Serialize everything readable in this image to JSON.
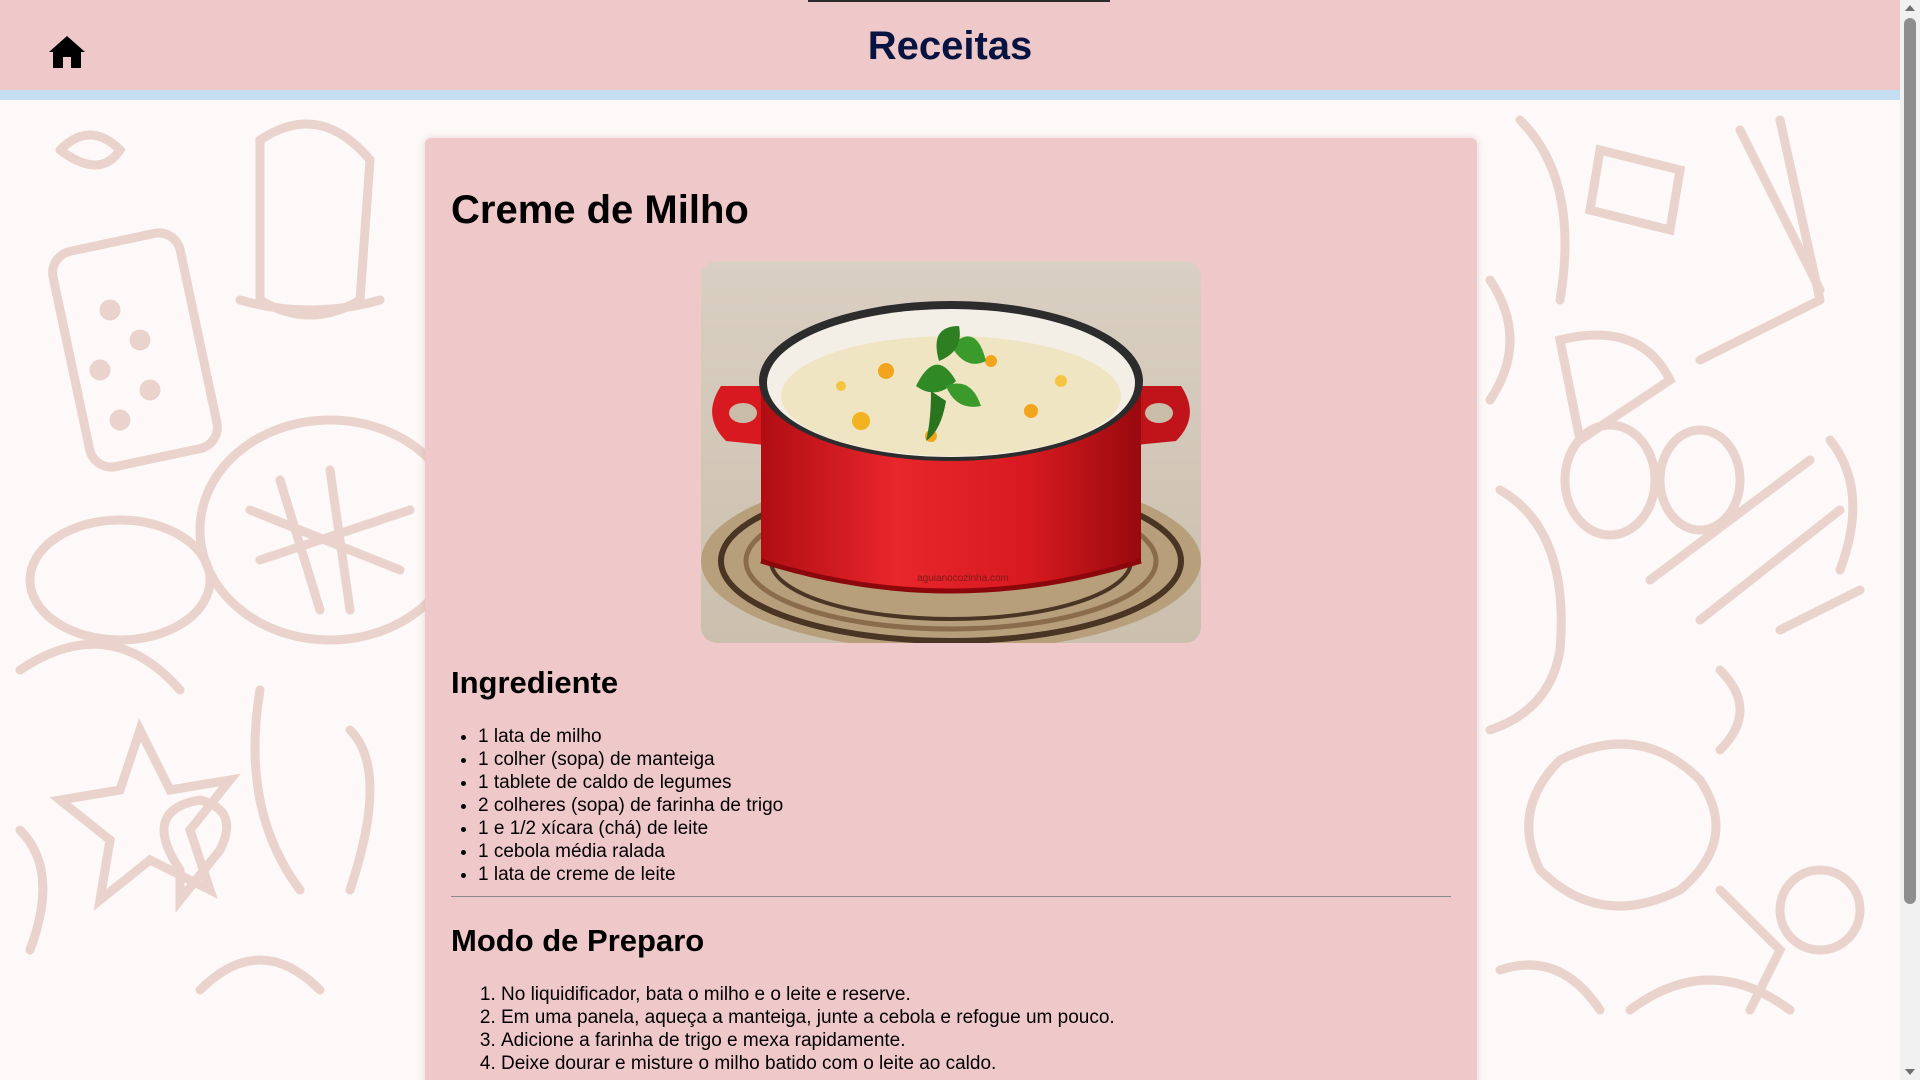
{
  "header": {
    "title": "Receitas",
    "home_icon": "home-icon",
    "bg_color": "#efc8c9",
    "accent_stripe": "#c4ddf0"
  },
  "recipe": {
    "title": "Creme de Milho",
    "image_alt": "Creme de milho em panela vermelha",
    "image_watermark": "aguianocozinha.com",
    "ingredients_title": "Ingrediente",
    "ingredients": [
      "1 lata de milho",
      "1 colher (sopa) de manteiga",
      "1 tablete de caldo de legumes",
      "2 colheres (sopa) de farinha de trigo",
      "1 e 1/2 xícara (chá) de leite",
      "1 cebola média ralada",
      "1 lata de creme de leite"
    ],
    "steps_title": "Modo de Preparo",
    "steps": [
      "No liquidificador, bata o milho e o leite e reserve.",
      "Em uma panela, aqueça a manteiga, junte a cebola e refogue um pouco.",
      "Adicione a farinha de trigo e mexa rapidamente.",
      "Deixe dourar e misture o milho batido com o leite ao caldo."
    ]
  }
}
